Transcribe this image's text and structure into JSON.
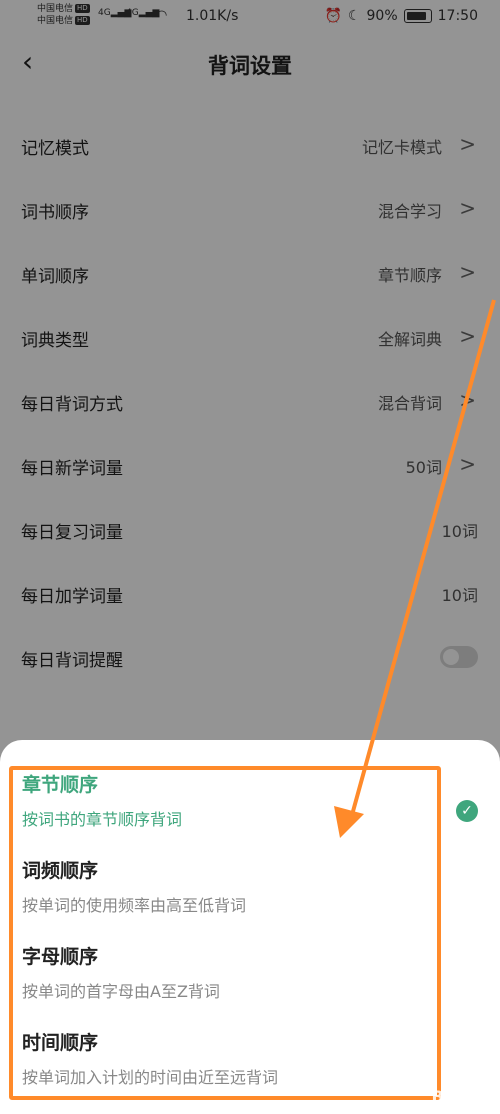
{
  "status_bar": {
    "carrier1": "中国电信",
    "carrier2": "中国电信",
    "hd": "HD",
    "net_speed": "1.01K/s",
    "battery": "90%",
    "time": "17:50"
  },
  "header": {
    "back_glyph": "‹",
    "title": "背词设置"
  },
  "settings": [
    {
      "label": "记忆模式",
      "value": "记忆卡模式"
    },
    {
      "label": "词书顺序",
      "value": "混合学习"
    },
    {
      "label": "单词顺序",
      "value": "章节顺序"
    },
    {
      "label": "词典类型",
      "value": "全解词典"
    },
    {
      "label": "每日背词方式",
      "value": "混合背词"
    },
    {
      "label": "每日新学词量",
      "value": "50词"
    },
    {
      "label": "每日复习词量",
      "value": "10词"
    },
    {
      "label": "每日加学词量",
      "value": "10词"
    },
    {
      "label": "每日背词提醒",
      "toggle": false
    }
  ],
  "sheet": {
    "options": [
      {
        "title": "章节顺序",
        "desc": "按词书的章节顺序背词",
        "selected": true
      },
      {
        "title": "词频顺序",
        "desc": "按单词的使用频率由高至低背词",
        "selected": false
      },
      {
        "title": "字母顺序",
        "desc": "按单词的首字母由A至Z背词",
        "selected": false
      },
      {
        "title": "时间顺序",
        "desc": "按单词加入计划的时间由近至远背词",
        "selected": false
      }
    ]
  },
  "colors": {
    "accent": "#3fa67d",
    "annotation": "#ff8a2a"
  },
  "watermark": "Bai经验"
}
